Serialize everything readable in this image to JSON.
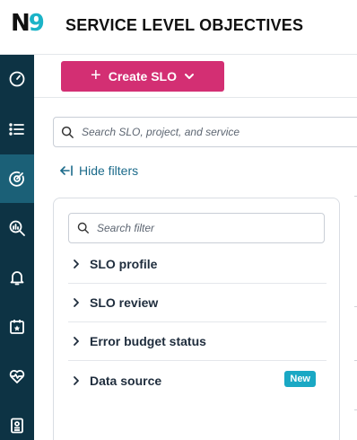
{
  "header": {
    "logo_letter": "N",
    "logo_digit": "9",
    "title": "SERVICE LEVEL OBJECTIVES"
  },
  "sidebar": {
    "items": [
      {
        "icon": "gauge-icon",
        "active": false
      },
      {
        "icon": "list-icon",
        "active": false
      },
      {
        "icon": "target-icon",
        "active": true
      },
      {
        "icon": "chart-search-icon",
        "active": false
      },
      {
        "icon": "bell-icon",
        "active": false
      },
      {
        "icon": "calendar-star-icon",
        "active": false
      },
      {
        "icon": "heart-pulse-icon",
        "active": false
      },
      {
        "icon": "report-icon",
        "active": false
      }
    ]
  },
  "toolbar": {
    "create_label": "Create SLO"
  },
  "search": {
    "placeholder": "Search SLO, project, and service"
  },
  "filters": {
    "hide_label": "Hide filters",
    "search_placeholder": "Search filter",
    "items": [
      {
        "label": "SLO profile"
      },
      {
        "label": "SLO review"
      },
      {
        "label": "Error budget status"
      },
      {
        "label": "Data source",
        "badge": "New"
      }
    ]
  },
  "colors": {
    "sidebar_bg": "#0d3344",
    "sidebar_active": "#1b6077",
    "primary_button": "#d32f73",
    "link": "#1b6a8a",
    "badge": "#1aa8c4",
    "logo_accent": "#1bb3c7"
  }
}
